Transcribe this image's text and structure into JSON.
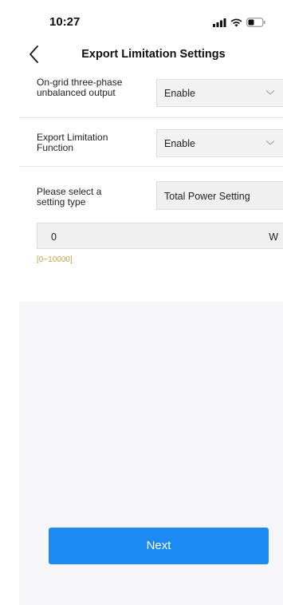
{
  "status_bar": {
    "time": "10:27",
    "icons": [
      "signal-icon",
      "wifi-icon",
      "battery-icon"
    ]
  },
  "header": {
    "title": "Export Limitation Settings",
    "back_icon": "chevron-left-icon"
  },
  "form": {
    "unbalanced_output": {
      "label": "On-grid three-phase unbalanced output",
      "value": "Enable"
    },
    "export_limitation": {
      "label": "Export Limitation Function",
      "value": "Enable"
    },
    "setting_type": {
      "label": "Please select a setting type",
      "value": "Total Power Setting"
    },
    "power": {
      "value": "0",
      "unit": "W",
      "range": "[0~10000]"
    }
  },
  "actions": {
    "next_label": "Next"
  },
  "colors": {
    "accent": "#1b8af2",
    "hint": "#c9a14a",
    "field_bg": "#f0f0f0",
    "page_bg": "#f6f6f8"
  }
}
